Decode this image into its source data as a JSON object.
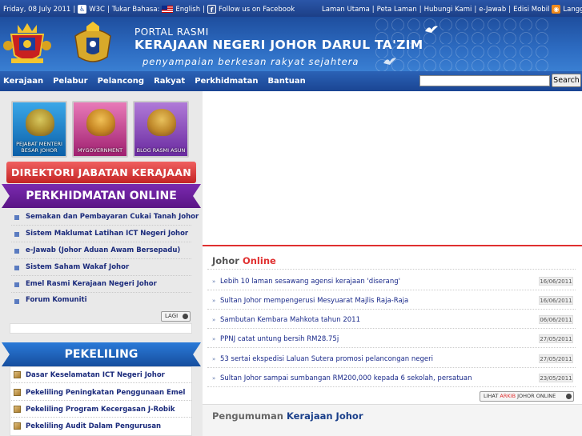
{
  "topbar": {
    "date": "Friday, 08 July 2011",
    "w3c": "W3C",
    "lang_label": "Tukar Bahasa:",
    "lang": "English",
    "facebook": "Follow us on Facebook",
    "links": [
      "Laman Utama",
      "Peta Laman",
      "Hubungi Kami",
      "e-Jawab",
      "Edisi Mobil"
    ],
    "rss": "Langgan RSS kami"
  },
  "header": {
    "line1": "PORTAL RASMI",
    "line2": "KERAJAAN NEGERI JOHOR DARUL TA'ZIM",
    "tagline": "penyampaian berkesan rakyat sejahtera"
  },
  "nav": {
    "items": [
      "Kerajaan",
      "Pelabur",
      "Pelancong",
      "Rakyat",
      "Perkhidmatan",
      "Bantuan"
    ],
    "search_button": "Search",
    "search_value": ""
  },
  "thumbs": [
    "PEJABAT MENTERI BESAR JOHOR",
    "MYGOVERNMENT",
    "BLOG RASMI ASUN"
  ],
  "direktori": "DIREKTORI JABATAN KERAJAAN",
  "online": {
    "title": "PERKHIDMATAN ONLINE",
    "items": [
      "Semakan dan Pembayaran Cukai Tanah Johor",
      "Sistem Maklumat Latihan ICT Negeri Johor",
      "e-Jawab (Johor Aduan Awam Bersepadu)",
      "Sistem Saham Wakaf Johor",
      "Emel Rasmi Kerajaan Negeri Johor",
      "Forum Komuniti"
    ],
    "more": "LAGI"
  },
  "pekeliling": {
    "title": "PEKELILING",
    "items": [
      "Dasar Keselamatan ICT Negeri Johor",
      "Pekeliling Peningkatan Penggunaan Emel",
      "Pekeliling Program Kecergasan J-Robik",
      "Pekeliling Audit Dalam Pengurusan"
    ]
  },
  "johor_online": {
    "title_a": "Johor",
    "title_b": "Online",
    "news": [
      {
        "t": "Lebih 10 laman sesawang agensi kerajaan 'diserang'",
        "d": "16/06/2011"
      },
      {
        "t": "Sultan Johor mempengerusi Mesyuarat Majlis Raja-Raja",
        "d": "16/06/2011"
      },
      {
        "t": "Sambutan Kembara Mahkota tahun 2011",
        "d": "06/06/2011"
      },
      {
        "t": "PPNJ catat untung bersih RM28.75j",
        "d": "27/05/2011"
      },
      {
        "t": "53 sertai ekspedisi Laluan Sutera promosi pelancongan negeri",
        "d": "27/05/2011"
      },
      {
        "t": "Sultan Johor sampai sumbangan RM200,000 kepada 6 sekolah, persatuan",
        "d": "23/05/2011"
      }
    ],
    "archive_a": "LIHAT",
    "archive_b": "ARKIB",
    "archive_c": "JOHOR ONLINE"
  },
  "pengumuman": {
    "title_a": "Pengumuman",
    "title_b": "Kerajaan Johor"
  },
  "colors": {
    "brand": "#1e4e9e",
    "accent": "#e03030",
    "purple": "#6a1f9a",
    "blue_ribbon": "#1b5fb8"
  }
}
